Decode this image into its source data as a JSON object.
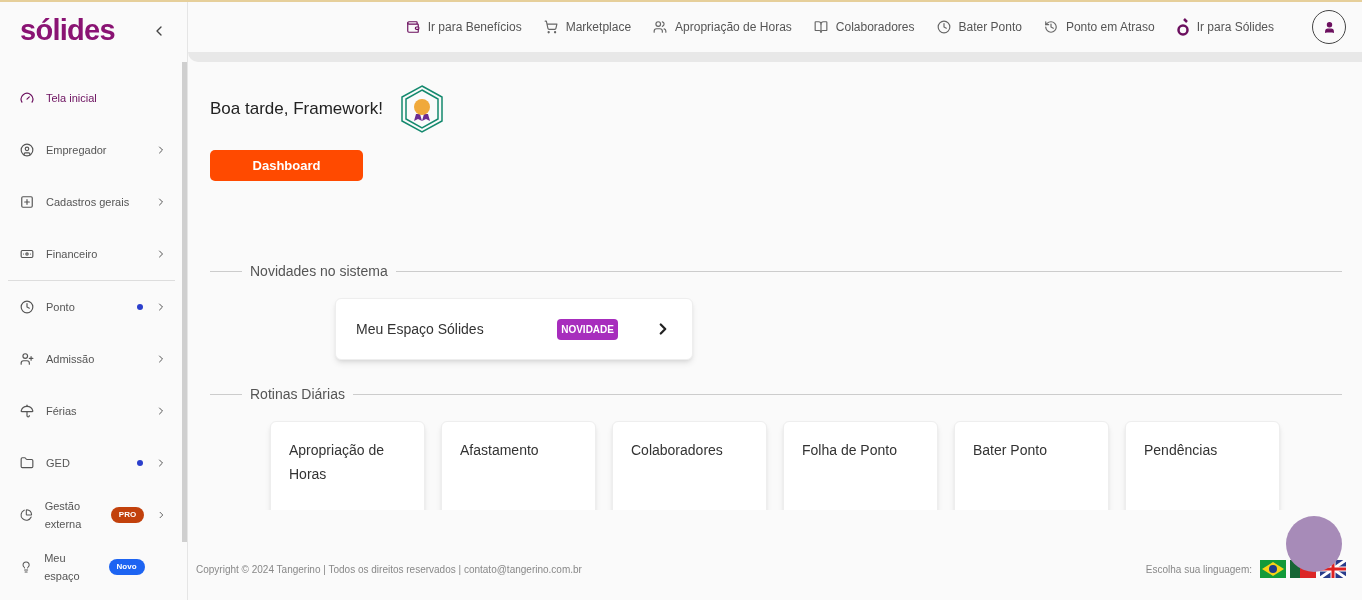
{
  "sidebar": {
    "logo": "sólides",
    "groups": [
      [
        {
          "label": "Tela inicial",
          "selected": true,
          "dot": false,
          "expandable": false
        },
        {
          "label": "Empregador",
          "selected": false,
          "dot": false,
          "expandable": true
        },
        {
          "label": "Cadastros gerais",
          "selected": false,
          "dot": false,
          "expandable": true
        },
        {
          "label": "Financeiro",
          "selected": false,
          "dot": false,
          "expandable": true
        }
      ],
      [
        {
          "label": "Ponto",
          "selected": false,
          "dot": true,
          "expandable": true
        },
        {
          "label": "Admissão",
          "selected": false,
          "dot": false,
          "expandable": true
        },
        {
          "label": "Férias",
          "selected": false,
          "dot": false,
          "expandable": true
        },
        {
          "label": "GED",
          "selected": false,
          "dot": true,
          "expandable": true
        },
        {
          "label": "Gestão externa",
          "selected": false,
          "dot": false,
          "expandable": true,
          "badge": "PRO",
          "color": "#c2410c"
        },
        {
          "label": "Meu espaço",
          "selected": false,
          "dot": false,
          "expandable": false,
          "badge": "Novo",
          "color": "#1d64f2"
        }
      ]
    ]
  },
  "topbar": {
    "links": [
      "Ir para Benefícios",
      "Marketplace",
      "Apropriação de Horas",
      "Colaboradores",
      "Bater Ponto",
      "Ponto em Atraso",
      "Ir para Sólides"
    ]
  },
  "greeting": "Boa tarde, Framework!",
  "dashboard_button": "Dashboard",
  "news": {
    "title": "Novidades no sistema",
    "card": {
      "title": "Meu Espaço Sólides",
      "badge": "NOVIDADE"
    }
  },
  "routines": {
    "title": "Rotinas Diárias",
    "cards": [
      "Apropriação de Horas",
      "Afastamento",
      "Colaboradores",
      "Folha de Ponto",
      "Bater Ponto",
      "Pendências"
    ]
  },
  "footer": {
    "copyright": "Copyright © 2024 Tangerino | Todos os direitos reservados | contato@tangerino.com.br",
    "language_label": "Escolha sua linguagem:"
  }
}
